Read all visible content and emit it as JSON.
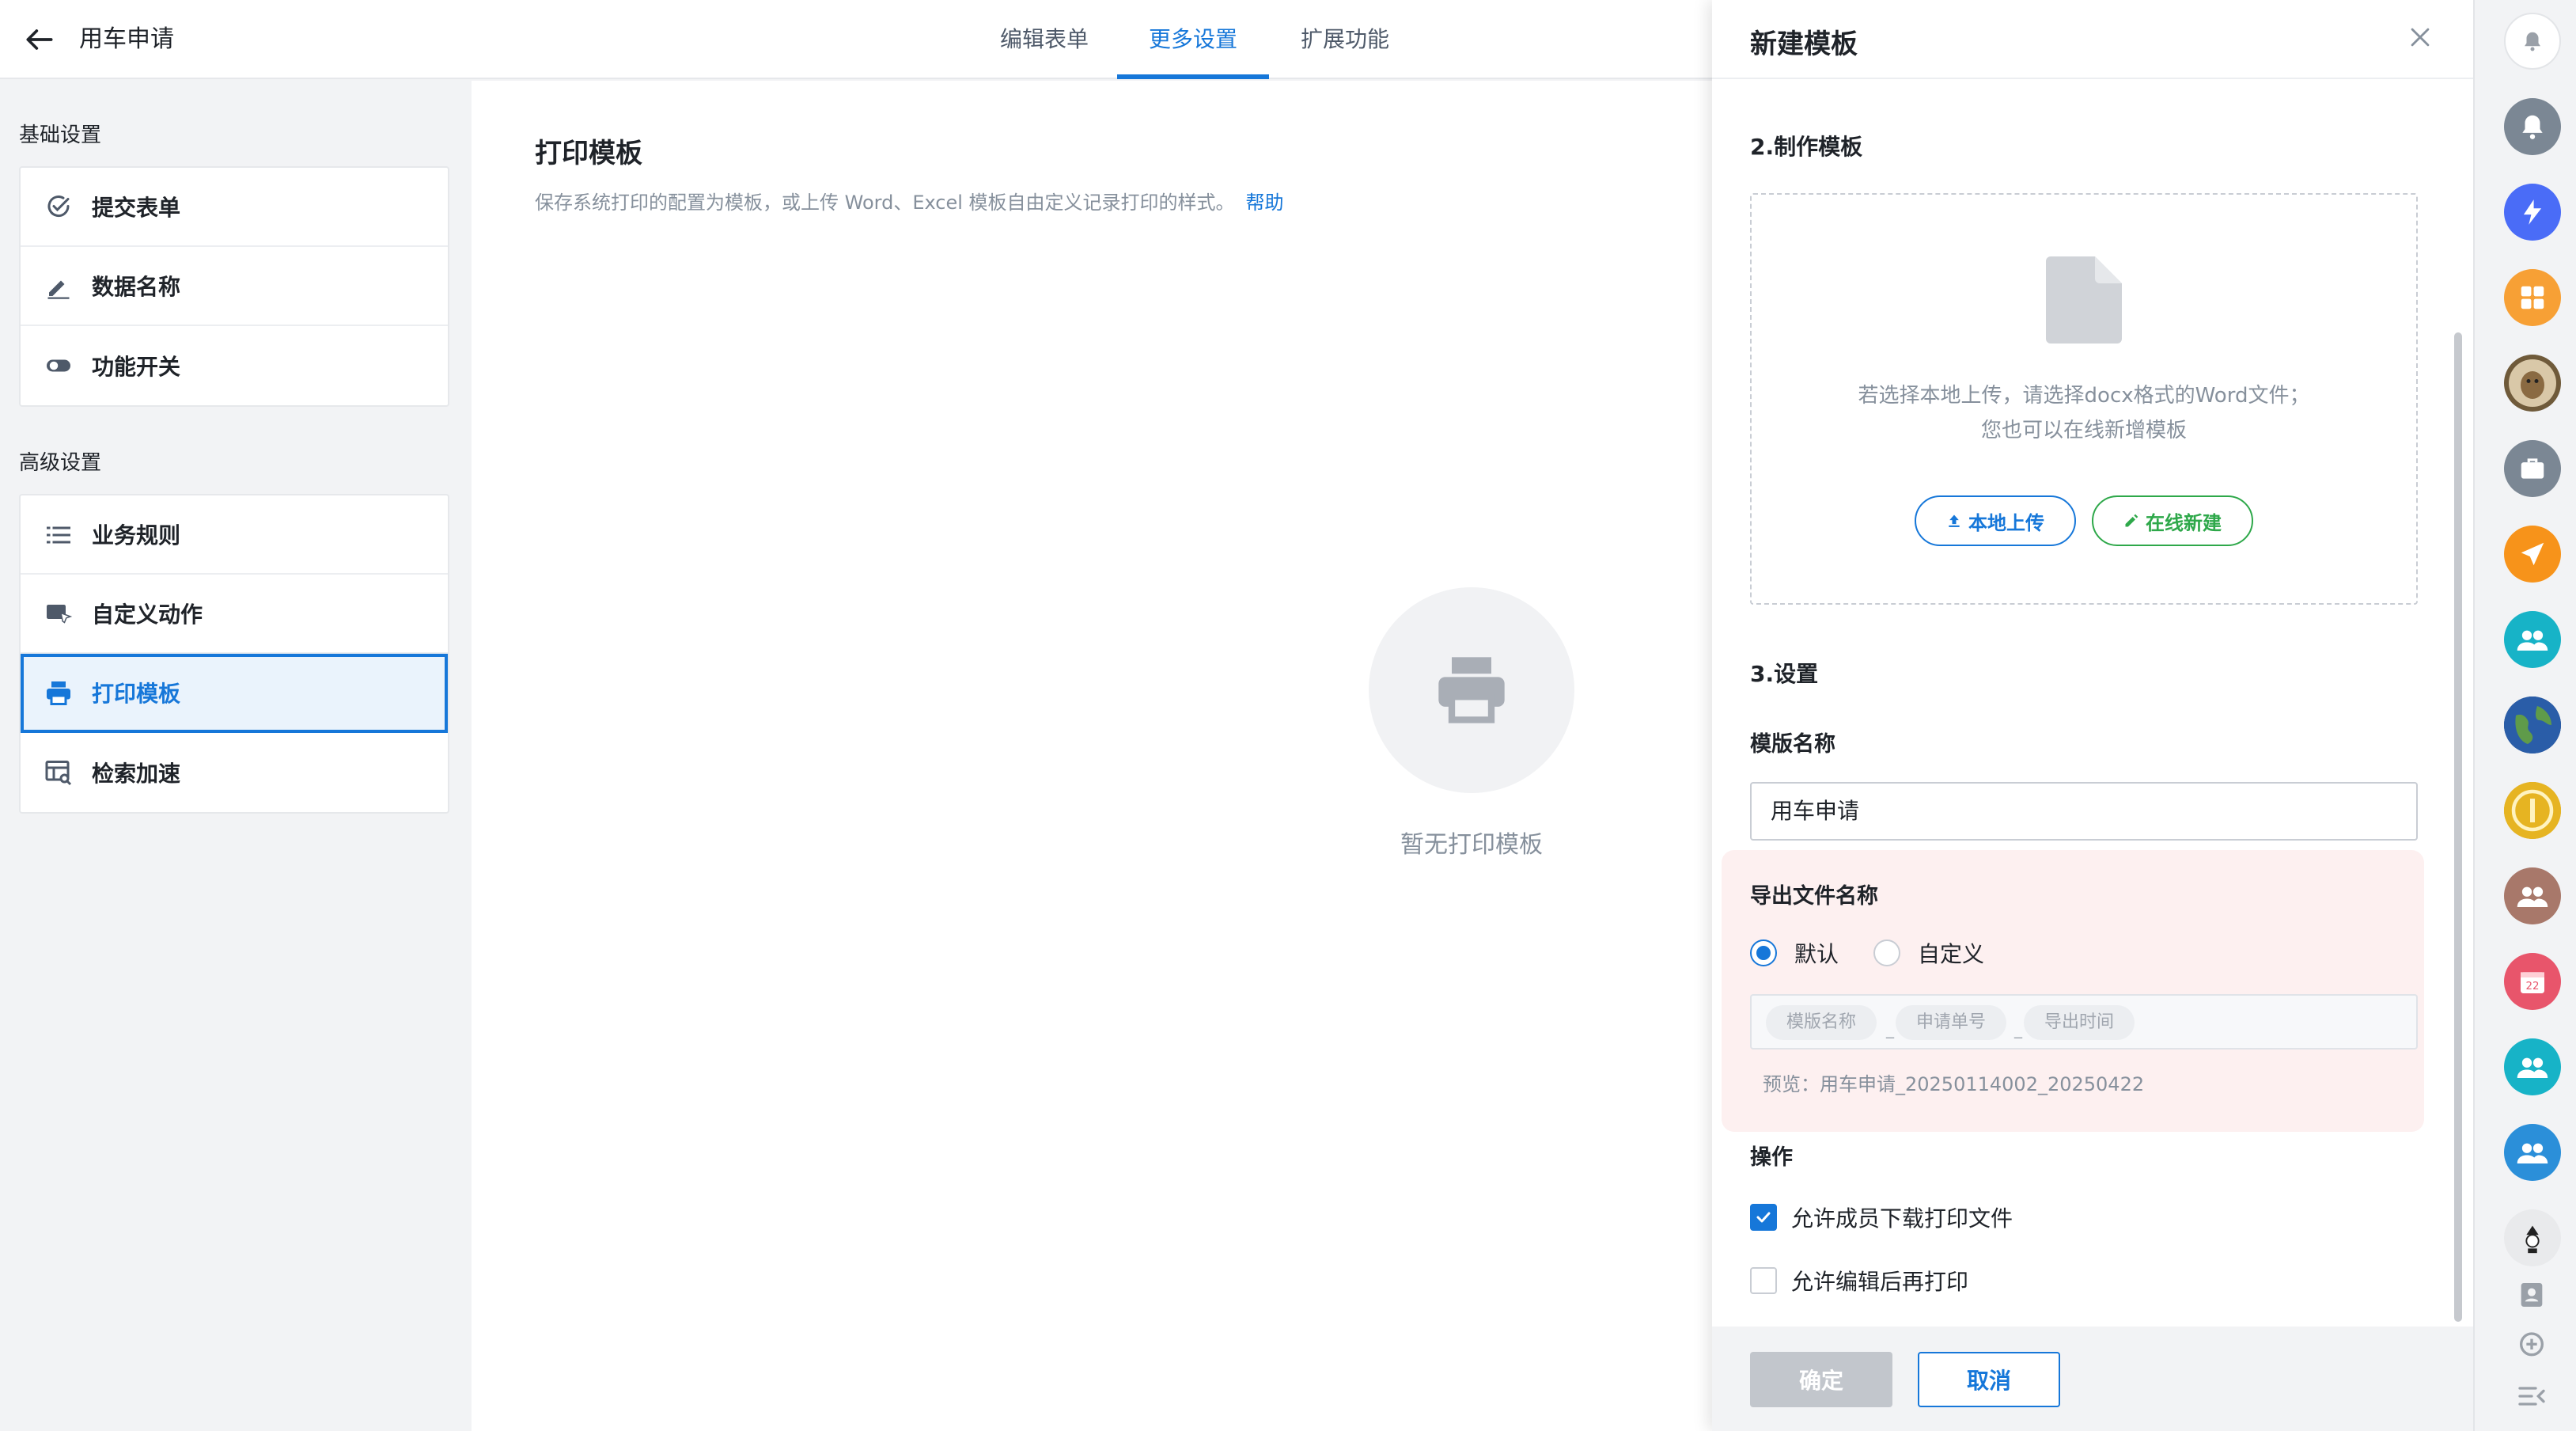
{
  "header": {
    "title": "用车申请",
    "tabs": [
      {
        "label": "编辑表单"
      },
      {
        "label": "更多设置",
        "active": true
      },
      {
        "label": "扩展功能"
      }
    ]
  },
  "sidebar": {
    "basic_group": "基础设置",
    "basic_items": [
      {
        "label": "提交表单",
        "icon": "check-circle-icon"
      },
      {
        "label": "数据名称",
        "icon": "pencil-icon"
      },
      {
        "label": "功能开关",
        "icon": "toggle-icon"
      }
    ],
    "advanced_group": "高级设置",
    "advanced_items": [
      {
        "label": "业务规则",
        "icon": "list-icon"
      },
      {
        "label": "自定义动作",
        "icon": "cursor-window-icon"
      },
      {
        "label": "打印模板",
        "icon": "printer-icon",
        "active": true
      },
      {
        "label": "检索加速",
        "icon": "search-table-icon"
      }
    ]
  },
  "main": {
    "title": "打印模板",
    "description": "保存系统打印的配置为模板，或上传 Word、Excel 模板自由定义记录打印的样式。",
    "help": "帮助",
    "empty_text": "暂无打印模板"
  },
  "dialog": {
    "title": "新建模板",
    "step2_title": "2.制作模板",
    "upload_hint_line1": "若选择本地上传，请选择docx格式的Word文件；",
    "upload_hint_line2": "您也可以在线新增模板",
    "local_upload": "本地上传",
    "online_new": "在线新建",
    "step3_title": "3.设置",
    "name_label": "模版名称",
    "name_value": "用车申请",
    "export_label": "导出文件名称",
    "radio_default": "默认",
    "radio_custom": "自定义",
    "selected_export_option": "默认",
    "tags": [
      "模版名称",
      "申请单号",
      "导出时间"
    ],
    "tag_separator": "_",
    "preview": "预览：用车申请_20250114002_20250422",
    "operations_label": "操作",
    "checkbox_download": "允许成员下载打印文件",
    "checkbox_download_checked": true,
    "checkbox_edit": "允许编辑后再打印",
    "checkbox_edit_checked": false,
    "confirm": "确定",
    "cancel": "取消"
  },
  "rail": {
    "calendar_day": "22",
    "colors": {
      "gray": "#7b8794",
      "blue": "#4a6cf7",
      "orange": "#f7a035",
      "teal": "#17b3c7",
      "brown": "#a8786a",
      "red": "#e8556b",
      "accent": "#1677d9"
    }
  }
}
